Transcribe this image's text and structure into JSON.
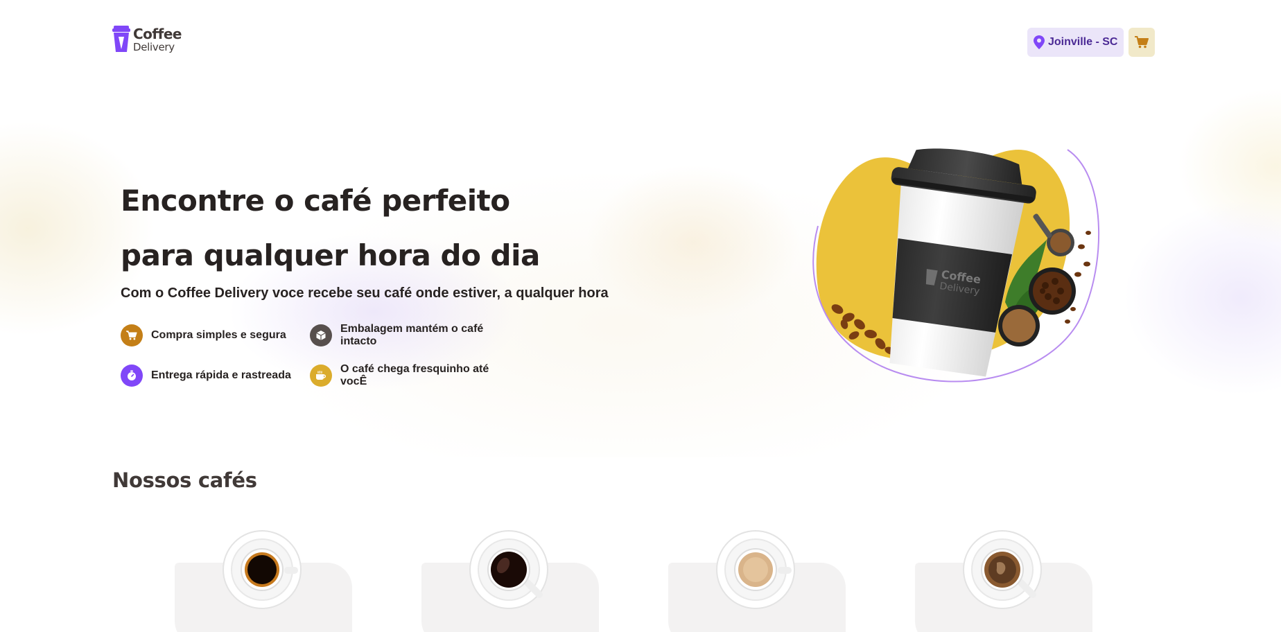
{
  "header": {
    "logo": {
      "title": "Coffee",
      "subtitle": "Delivery"
    },
    "location": "Joinville - SC",
    "cart_icon": "shopping-cart-icon"
  },
  "hero": {
    "title_line1": "Encontre o café perfeito",
    "title_line2": "para qualquer hora do dia",
    "subtitle": "Com o Coffee Delivery voce recebe seu café onde estiver, a qualquer hora",
    "benefits": [
      {
        "label": "Compra simples e segura",
        "icon": "shopping-cart-icon",
        "color": "#C47F17"
      },
      {
        "label": "Embalagem mantém o café intacto",
        "icon": "package-icon",
        "color": "#574F4D"
      },
      {
        "label": "Entrega rápida e rastreada",
        "icon": "timer-icon",
        "color": "#8047F8"
      },
      {
        "label": "O café chega fresquinho até vocÊ",
        "icon": "coffee-icon",
        "color": "#DBAC2C"
      }
    ],
    "image_logo_text": [
      "Coffee",
      "Delivery"
    ]
  },
  "section": {
    "title": "Nossos cafés"
  },
  "coffees": [
    {
      "variant": "espresso"
    },
    {
      "variant": "americano"
    },
    {
      "variant": "latte"
    },
    {
      "variant": "cappuccino"
    }
  ],
  "colors": {
    "purple": "#8047F8",
    "purple_dark": "#4B2995",
    "purple_light": "#EBE5F9",
    "yellow": "#DBAC2C",
    "yellow_dark": "#C47F17",
    "yellow_light": "#F1E9C9",
    "base_card": "#F3F2F2",
    "base_title": "#272221"
  }
}
